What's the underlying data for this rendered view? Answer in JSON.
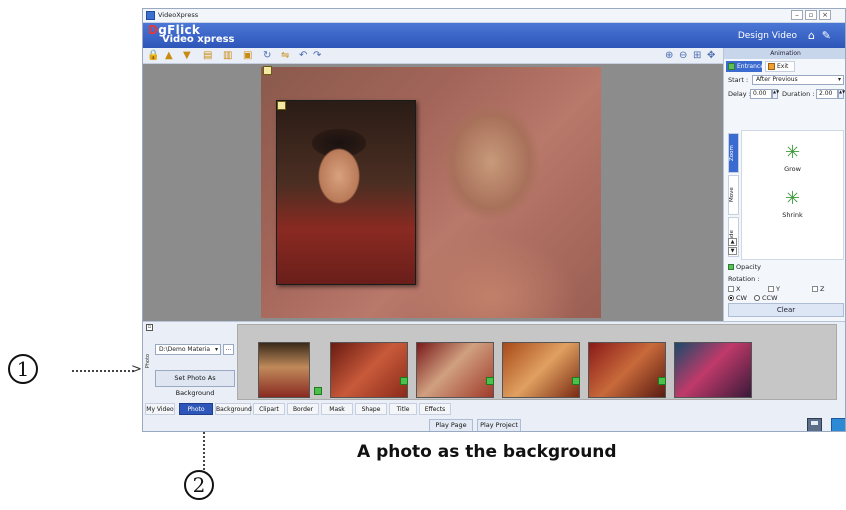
{
  "window": {
    "title": "VideoXpress"
  },
  "logo": {
    "line1_prefix": "D",
    "line1_rest": "gFlick",
    "line2": "Video xpress"
  },
  "header": {
    "design_label": "Design Video"
  },
  "animation_panel": {
    "title": "Animation",
    "tab_entrance": "Entrance",
    "tab_exit": "Exit",
    "start_label": "Start :",
    "start_value": "After Previous",
    "delay_label": "Delay :",
    "delay_value": "0.00",
    "duration_label": "Duration :",
    "duration_value": "2.00",
    "side_tabs": [
      "Zoom",
      "Move",
      "Fade"
    ],
    "effects": [
      "Grow",
      "Shrink"
    ],
    "opacity_label": "Opacity",
    "rotation_label": "Rotation :",
    "rotation_x": "X",
    "rotation_y": "Y",
    "rotation_z": "Z",
    "dir_cw": "CW",
    "dir_ccw": "CCW",
    "clear_label": "Clear"
  },
  "photo_panel": {
    "side_label": "Photo",
    "path_value": "D:\\Demo Materia",
    "browse_label": "...",
    "set_bg_label": "Set Photo As Background"
  },
  "bottom_tabs": [
    "My Video",
    "Photo",
    "Background",
    "Clipart",
    "Border",
    "Mask",
    "Shape",
    "Title",
    "Effects"
  ],
  "play": {
    "page_label": "Play Page",
    "project_label": "Play Project"
  },
  "annotations": {
    "marker1": "1",
    "marker2": "2",
    "caption": "A photo as the background"
  },
  "colors": {
    "header_blue": "#2d56b8",
    "active_tab": "#2d56b8",
    "accent_green": "#4cbf4c"
  }
}
